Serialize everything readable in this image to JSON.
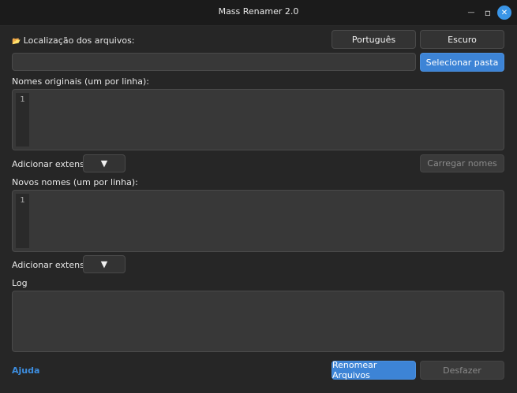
{
  "window": {
    "title": "Mass Renamer 2.0",
    "minimize_glyph": "—",
    "maximize_glyph": "▫",
    "close_glyph": "✕"
  },
  "location": {
    "icon": "📂",
    "label": "Localização dos arquivos:",
    "path_value": "",
    "select_button": "Selecionar pasta"
  },
  "toolbar": {
    "language_button": "Português",
    "theme_button": "Escuro"
  },
  "originals": {
    "label": "Nomes originais (um por linha):",
    "line_number": "1",
    "add_extension_label": "Adicionar extensão:",
    "dropdown_glyph": "▼",
    "load_button": "Carregar nomes"
  },
  "new_names": {
    "label": "Novos nomes (um por linha):",
    "line_number": "1",
    "add_extension_label": "Adicionar extensão:",
    "dropdown_glyph": "▼"
  },
  "log": {
    "label": "Log"
  },
  "footer": {
    "help_link": "Ajuda",
    "rename_button": "Renomear Arquivos",
    "undo_button": "Desfazer"
  },
  "colors": {
    "accent": "#3d84d6",
    "background": "#262626",
    "close_button": "#3a96e8"
  }
}
